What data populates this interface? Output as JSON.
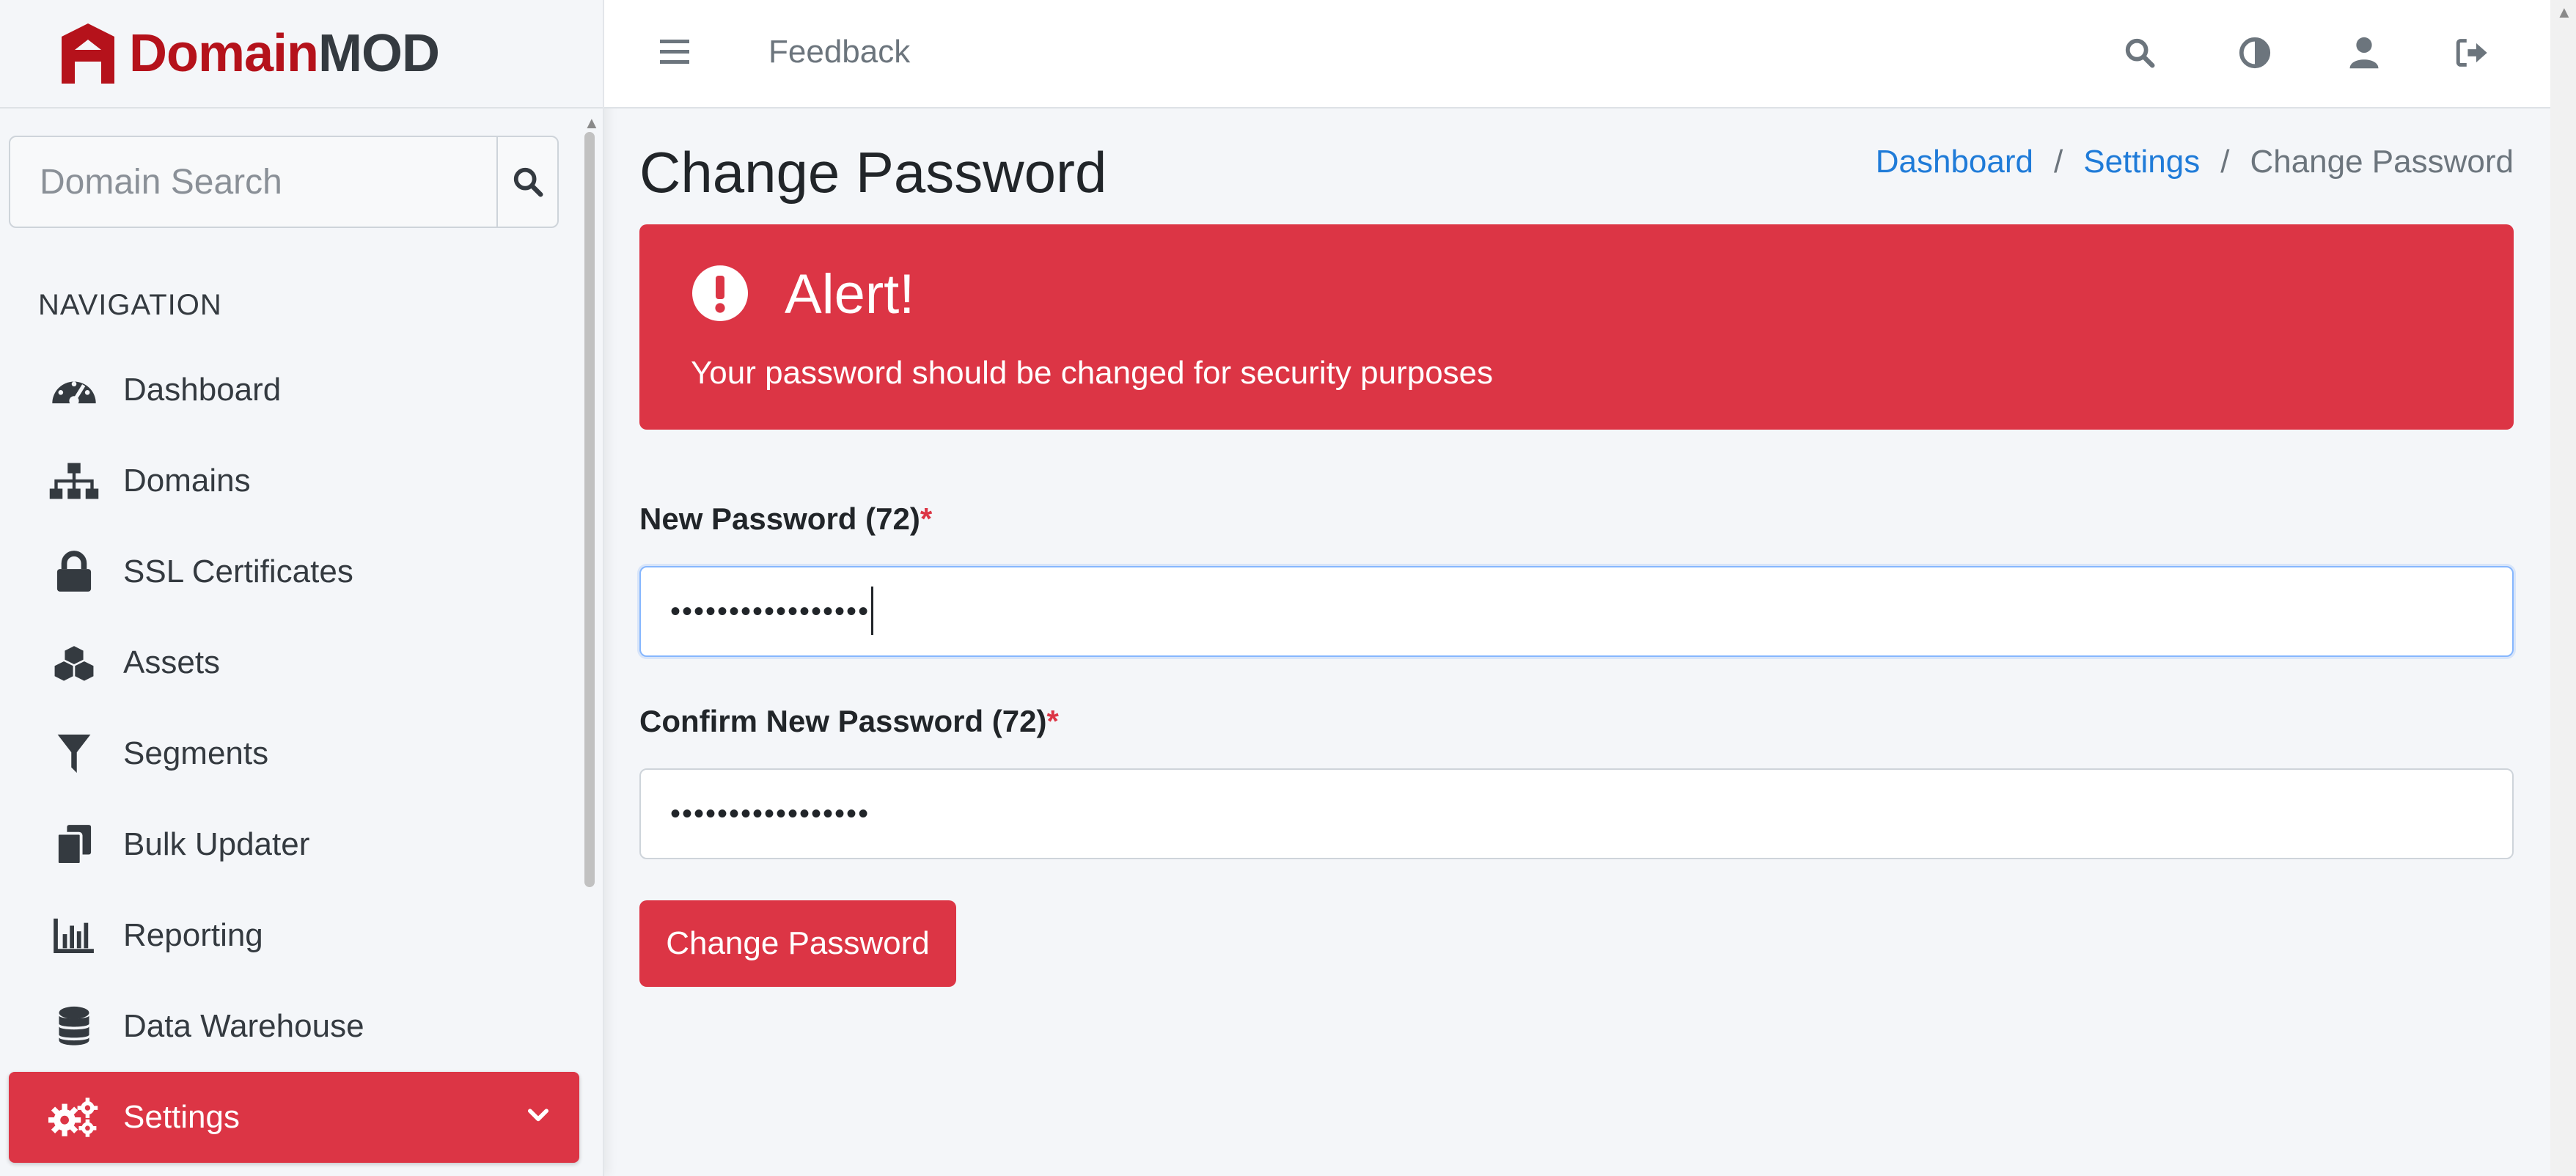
{
  "brand": {
    "name_part1": "Domain",
    "name_part2": "MOD",
    "accent": "#b5121b"
  },
  "search": {
    "placeholder": "Domain Search",
    "icon": "search-icon"
  },
  "nav": {
    "header": "NAVIGATION",
    "items": [
      {
        "label": "Dashboard",
        "icon": "tachometer-icon"
      },
      {
        "label": "Domains",
        "icon": "sitemap-icon"
      },
      {
        "label": "SSL Certificates",
        "icon": "lock-icon"
      },
      {
        "label": "Assets",
        "icon": "cubes-icon"
      },
      {
        "label": "Segments",
        "icon": "filter-icon"
      },
      {
        "label": "Bulk Updater",
        "icon": "copy-icon"
      },
      {
        "label": "Reporting",
        "icon": "chart-bar-icon"
      },
      {
        "label": "Data Warehouse",
        "icon": "database-icon"
      },
      {
        "label": "Settings",
        "icon": "cogs-icon",
        "active": true
      }
    ]
  },
  "topbar": {
    "menu_icon": "hamburger-icon",
    "feedback_label": "Feedback",
    "right_icons": [
      "search-icon",
      "contrast-icon",
      "user-icon",
      "logout-icon"
    ]
  },
  "page": {
    "title": "Change Password",
    "breadcrumb": [
      "Dashboard",
      "Settings",
      "Change Password"
    ]
  },
  "alert": {
    "title": "Alert!",
    "message": "Your password should be changed for security purposes",
    "color": "#dc3545"
  },
  "form": {
    "new_password_label": "New Password (72)",
    "new_password_value": "•••••••••••••••••",
    "confirm_password_label": "Confirm New Password (72)",
    "confirm_password_value": "•••••••••••••••••",
    "required_mark": "*",
    "submit_label": "Change Password"
  }
}
